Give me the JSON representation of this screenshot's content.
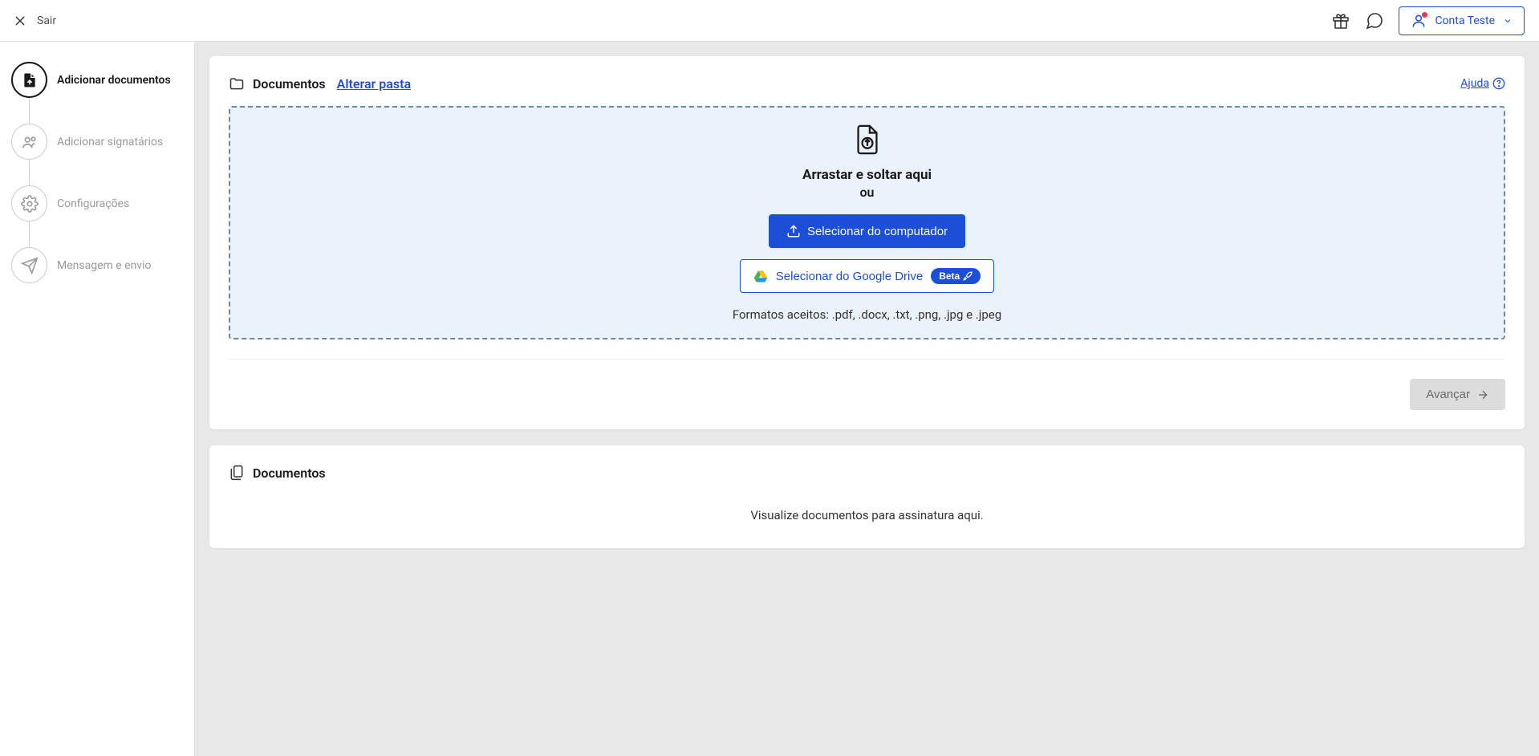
{
  "header": {
    "exit_label": "Sair",
    "account_label": "Conta Teste"
  },
  "sidebar": {
    "steps": [
      {
        "label": "Adicionar documentos",
        "type": "document"
      },
      {
        "label": "Adicionar signatários",
        "type": "people"
      },
      {
        "label": "Configurações",
        "type": "settings"
      },
      {
        "label": "Mensagem e envio",
        "type": "send"
      }
    ]
  },
  "upload_card": {
    "folder_label": "Documentos",
    "change_folder": "Alterar pasta",
    "help_label": "Ajuda",
    "drop_title": "Arrastar e soltar aqui",
    "drop_or": "ou",
    "select_computer": "Selecionar do computador",
    "select_gdrive": "Selecionar do Google Drive",
    "beta": "Beta",
    "formats": "Formatos aceitos: .pdf, .docx, .txt, .png, .jpg e .jpeg",
    "next_button": "Avançar"
  },
  "docs_list": {
    "title": "Documentos",
    "empty": "Visualize documentos para assinatura aqui."
  }
}
